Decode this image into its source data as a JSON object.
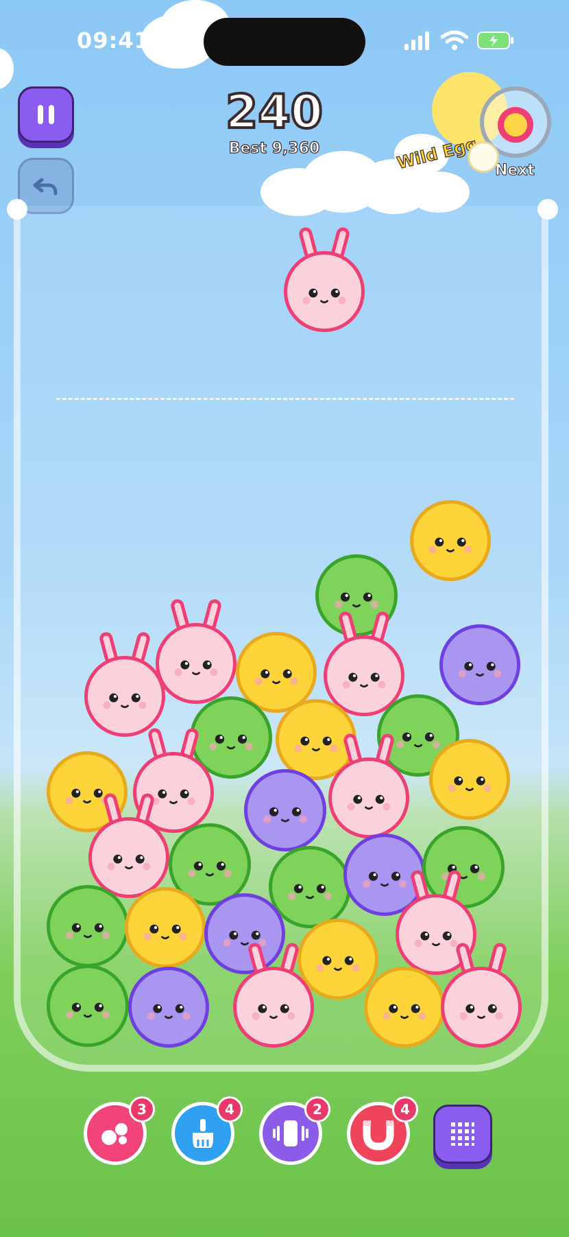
{
  "status_bar": {
    "time": "09:41"
  },
  "score": {
    "current": "240",
    "best_label": "Best 9,360"
  },
  "next": {
    "label": "Next",
    "wild_label": "Wild Egg"
  },
  "colors": {
    "pink": "#fbd1dc",
    "pink_border": "#ef3e74",
    "yellow": "#fdd33a",
    "yellow_border": "#e9a91d",
    "green": "#7fd35a",
    "green_border": "#3aa32c",
    "purple": "#a896f0",
    "purple_border": "#6f3fe0"
  },
  "powerups": [
    {
      "name": "split",
      "count": "3",
      "color": "#f0447a",
      "icon": "bubbles-icon"
    },
    {
      "name": "sweep",
      "count": "4",
      "color": "#2f9ff0",
      "icon": "brush-icon"
    },
    {
      "name": "shake",
      "count": "2",
      "color": "#8b5ce8",
      "icon": "phone-shake-icon"
    },
    {
      "name": "magnet",
      "count": "4",
      "color": "#f0445c",
      "icon": "magnet-icon"
    }
  ],
  "buttons": {
    "pause": "pause-icon",
    "undo": "undo-icon",
    "grid": "grid-icon"
  }
}
